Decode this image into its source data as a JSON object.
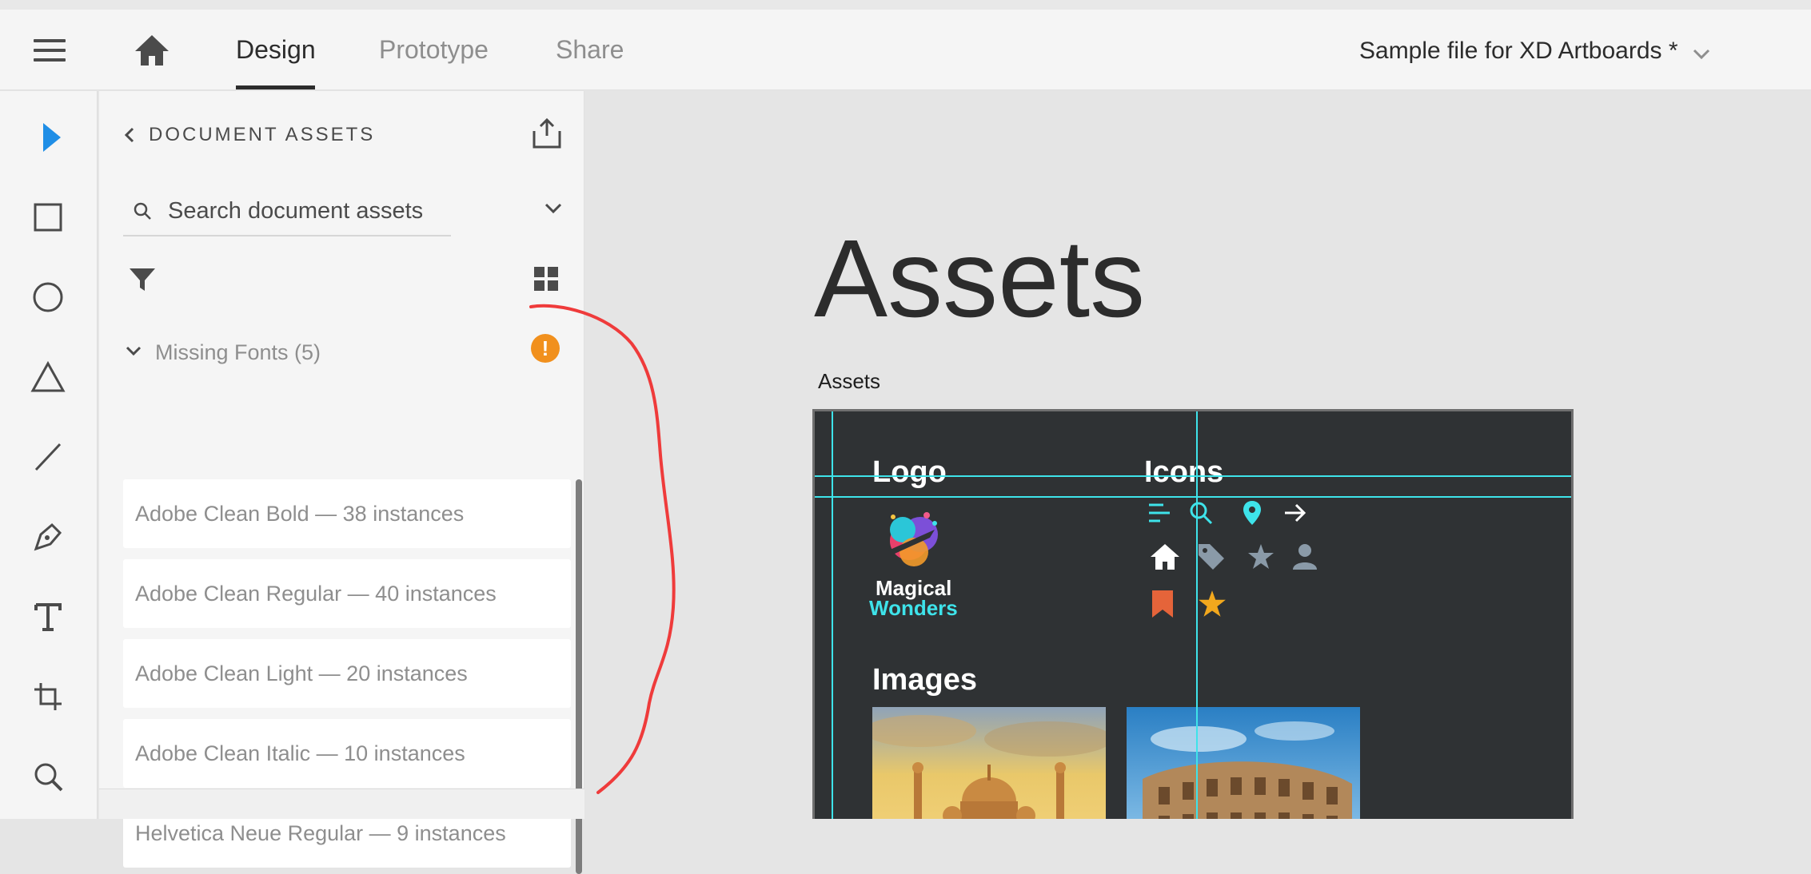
{
  "topbar": {
    "tabs": [
      {
        "label": "Design"
      },
      {
        "label": "Prototype"
      },
      {
        "label": "Share"
      }
    ],
    "document_title": "Sample file for XD Artboards *"
  },
  "toolbar": {
    "tools": [
      "select-icon",
      "rectangle-icon",
      "ellipse-icon",
      "polygon-icon",
      "line-icon",
      "pen-icon",
      "text-icon",
      "artboard-icon",
      "zoom-icon"
    ]
  },
  "panel": {
    "heading": "DOCUMENT ASSETS",
    "search_placeholder": "Search document assets",
    "missing_fonts_label": "Missing Fonts (5)",
    "warning_glyph": "!",
    "fonts": [
      {
        "label": "Adobe Clean Bold — 38 instances"
      },
      {
        "label": "Adobe Clean Regular — 40 instances"
      },
      {
        "label": "Adobe Clean Light — 20 instances"
      },
      {
        "label": "Adobe Clean Italic — 10 instances"
      },
      {
        "label": "Helvetica Neue Regular — 9 instances"
      }
    ]
  },
  "canvas": {
    "title": "Assets",
    "artboard_label": "Assets",
    "artboard": {
      "logo_heading": "Logo",
      "icons_heading": "Icons",
      "images_heading": "Images",
      "logo_word1": "Magical",
      "logo_word2": "Wonders"
    }
  },
  "colors": {
    "accent_blue": "#1f8ee6",
    "guide_cyan": "#3ee3ea",
    "warning_orange": "#f1901d",
    "annotation_red": "#ef3b3b",
    "artboard_bg": "#2f3234"
  }
}
